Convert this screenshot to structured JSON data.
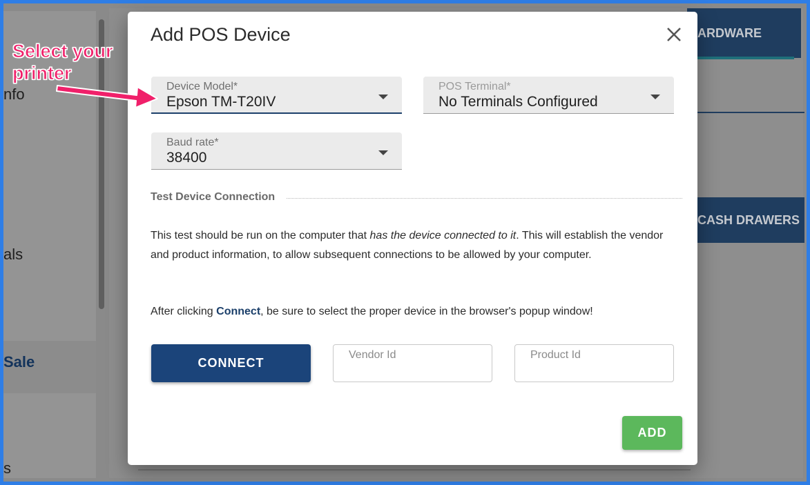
{
  "background": {
    "sidebar_items": [
      "nfo",
      "als",
      "Sale",
      "s"
    ],
    "tab_label": "ARDWARE",
    "button_label": "CASH DRAWERS"
  },
  "annotation": {
    "text_line1": "Select your",
    "text_line2": "printer",
    "color": "#f0206a"
  },
  "dialog": {
    "title": "Add POS Device",
    "close_icon": "close-icon",
    "device_model": {
      "label": "Device Model*",
      "value": "Epson TM-T20IV"
    },
    "pos_terminal": {
      "label": "POS Terminal*",
      "value": "No Terminals Configured"
    },
    "baud_rate": {
      "label": "Baud rate*",
      "value": "38400"
    },
    "section_title": "Test Device Connection",
    "para1_a": "This test should be run on the computer that ",
    "para1_em": "has the device connected to it",
    "para1_b": ". This will establish the vendor and product information, to allow subsequent connections to be allowed by your computer.",
    "para2_a": "After clicking ",
    "para2_strong": "Connect",
    "para2_b": ", be sure to select the proper device in the browser's popup window!",
    "connect_label": "CONNECT",
    "vendor_id_placeholder": "Vendor Id",
    "product_id_placeholder": "Product Id",
    "add_label": "ADD",
    "colors": {
      "primary": "#1b447a",
      "success": "#5cb85c"
    }
  }
}
